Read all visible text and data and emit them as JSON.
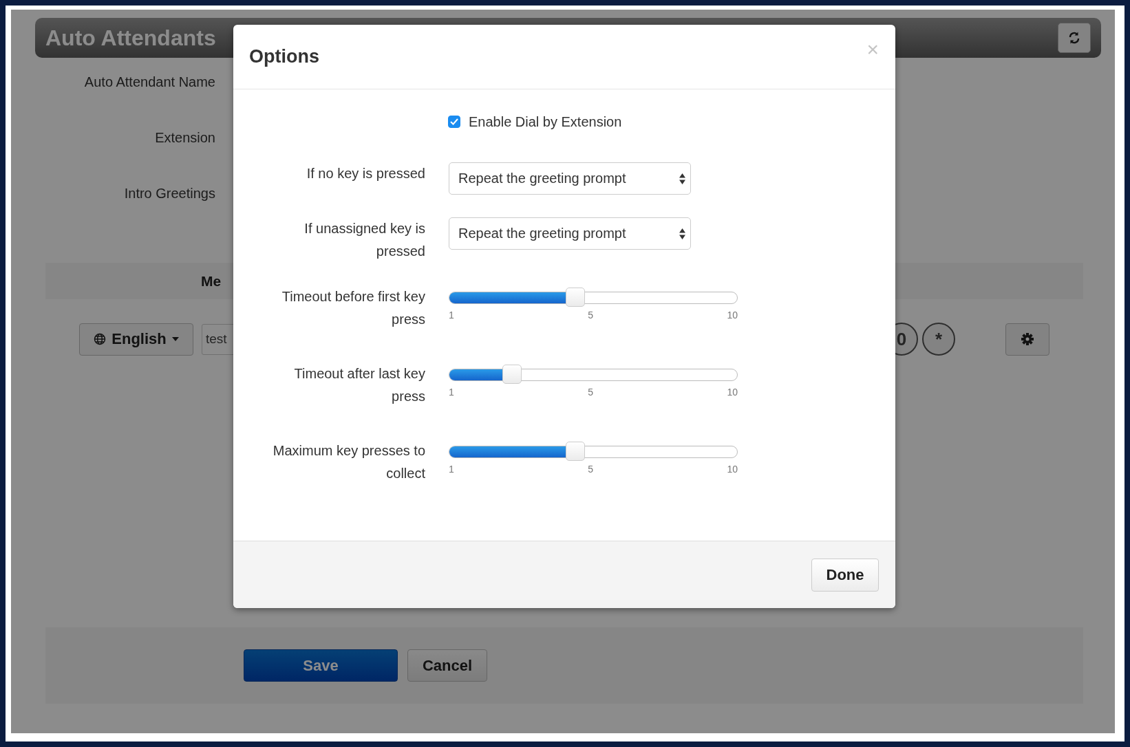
{
  "background": {
    "title": "Auto Attendants",
    "form_labels": [
      "Auto Attendant Name",
      "Extension",
      "Intro Greetings"
    ],
    "table_header": "Me",
    "language_button": "English",
    "greeting_input": {
      "value": "test"
    },
    "keys": [
      "0",
      "*"
    ],
    "buttons": [
      {
        "label": "Save",
        "kind": "primary"
      },
      {
        "label": "Cancel",
        "kind": "default"
      }
    ]
  },
  "dialog": {
    "title": "Options",
    "close": "×",
    "dial_by_extension": {
      "label": "Enable Dial by Extension",
      "checked": true
    },
    "selects": [
      {
        "label": "If no key is pressed",
        "value": "Repeat the greeting prompt"
      },
      {
        "label": "If unassigned key is pressed",
        "value": "Repeat the greeting prompt"
      }
    ],
    "sliders": [
      {
        "label": "Timeout before first key press",
        "level": 0.44,
        "ticks": [
          "1",
          "5",
          "10"
        ]
      },
      {
        "label": "Timeout after last key press",
        "level": 0.22,
        "ticks": [
          "1",
          "5",
          "10"
        ]
      },
      {
        "label": "Maximum key presses to collect",
        "level": 0.44,
        "ticks": [
          "1",
          "5",
          "10"
        ]
      }
    ],
    "done_button": "Done"
  }
}
